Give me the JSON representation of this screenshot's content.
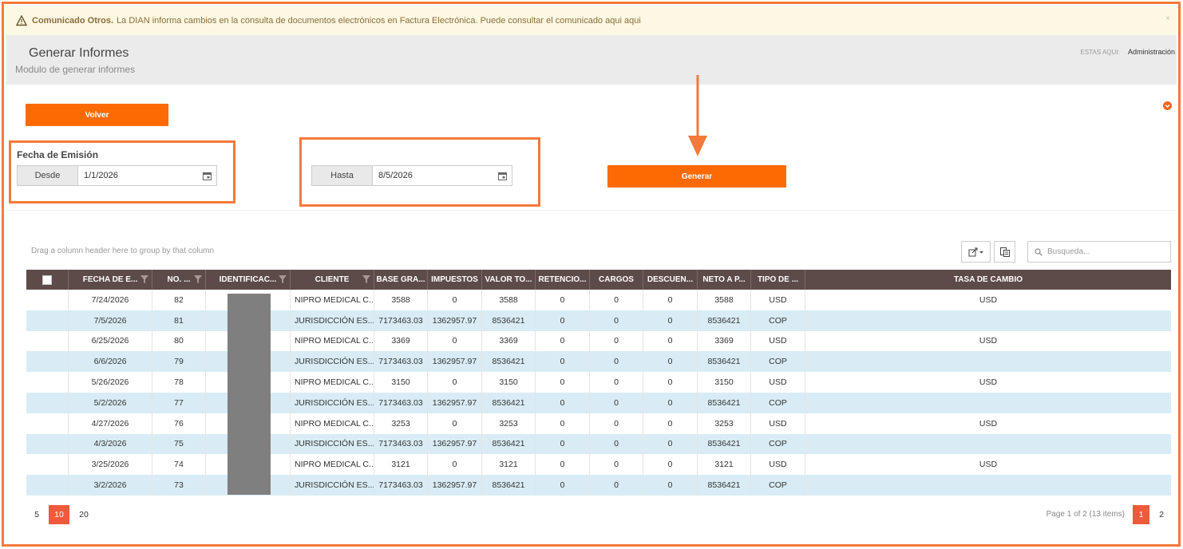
{
  "notice": {
    "title": "Comunicado Otros.",
    "message": "La DIAN informa cambios en la consulta de documentos electrónicos en Factura Electrónica. Puede consultar el comunicado aqui aqui",
    "close": "×"
  },
  "header": {
    "title": "Generar Informes",
    "subtitle": "Modulo de generar informes",
    "breadcrumb_label": "ESTAS AQUI:",
    "breadcrumb_current": "Administración"
  },
  "actions": {
    "back_label": "Volver",
    "generate_label": "Generar"
  },
  "filters": {
    "label": "Fecha de Emisión",
    "from_label": "Desde",
    "from_value": "1/1/2026",
    "to_label": "Hasta",
    "to_value": "8/5/2026"
  },
  "grid": {
    "group_hint": "Drag a column header here to group by that column",
    "search_placeholder": "Busqueda...",
    "columns": [
      "FECHA DE E...",
      "NO. ...",
      "IDENTIFICAC...",
      "CLIENTE",
      "BASE GRA...",
      "IMPUESTOS",
      "VALOR TO...",
      "RETENCIO...",
      "CARGOS",
      "DESCUEN...",
      "NETO A P...",
      "TIPO DE ...",
      "TASA DE CAMBIO"
    ],
    "rows": [
      [
        "7/24/2026",
        "82",
        "",
        "NIPRO MEDICAL C...",
        "3588",
        "0",
        "3588",
        "0",
        "0",
        "0",
        "3588",
        "USD",
        "USD"
      ],
      [
        "7/5/2026",
        "81",
        "",
        "JURISDICCIÓN ES...",
        "7173463.03",
        "1362957.97",
        "8536421",
        "0",
        "0",
        "0",
        "8536421",
        "COP",
        ""
      ],
      [
        "6/25/2026",
        "80",
        "",
        "NIPRO MEDICAL C...",
        "3369",
        "0",
        "3369",
        "0",
        "0",
        "0",
        "3369",
        "USD",
        "USD"
      ],
      [
        "6/6/2026",
        "79",
        "",
        "JURISDICCIÓN ES...",
        "7173463.03",
        "1362957.97",
        "8536421",
        "0",
        "0",
        "0",
        "8536421",
        "COP",
        ""
      ],
      [
        "5/26/2026",
        "78",
        "",
        "NIPRO MEDICAL C...",
        "3150",
        "0",
        "3150",
        "0",
        "0",
        "0",
        "3150",
        "USD",
        "USD"
      ],
      [
        "5/2/2026",
        "77",
        "",
        "JURISDICCIÓN ES...",
        "7173463.03",
        "1362957.97",
        "8536421",
        "0",
        "0",
        "0",
        "8536421",
        "COP",
        ""
      ],
      [
        "4/27/2026",
        "76",
        "",
        "NIPRO MEDICAL C...",
        "3253",
        "0",
        "3253",
        "0",
        "0",
        "0",
        "3253",
        "USD",
        "USD"
      ],
      [
        "4/3/2026",
        "75",
        "",
        "JURISDICCIÓN ES...",
        "7173463.03",
        "1362957.97",
        "8536421",
        "0",
        "0",
        "0",
        "8536421",
        "COP",
        ""
      ],
      [
        "3/25/2026",
        "74",
        "",
        "NIPRO MEDICAL C...",
        "3121",
        "0",
        "3121",
        "0",
        "0",
        "0",
        "3121",
        "USD",
        "USD"
      ],
      [
        "3/2/2026",
        "73",
        "",
        "JURISDICCIÓN ES...",
        "7173463.03",
        "1362957.97",
        "8536421",
        "0",
        "0",
        "0",
        "8536421",
        "COP",
        ""
      ]
    ]
  },
  "pager": {
    "sizes": [
      "5",
      "10",
      "20"
    ],
    "active_size": "10",
    "info": "Page 1 of 2 (13 items)",
    "pages": [
      "1",
      "2"
    ],
    "active_page": "1"
  },
  "colors": {
    "accent": "#fd6a03",
    "highlight": "#f5793a",
    "header_bg": "#5d4b4a",
    "alt_row": "#d9ecf5"
  }
}
